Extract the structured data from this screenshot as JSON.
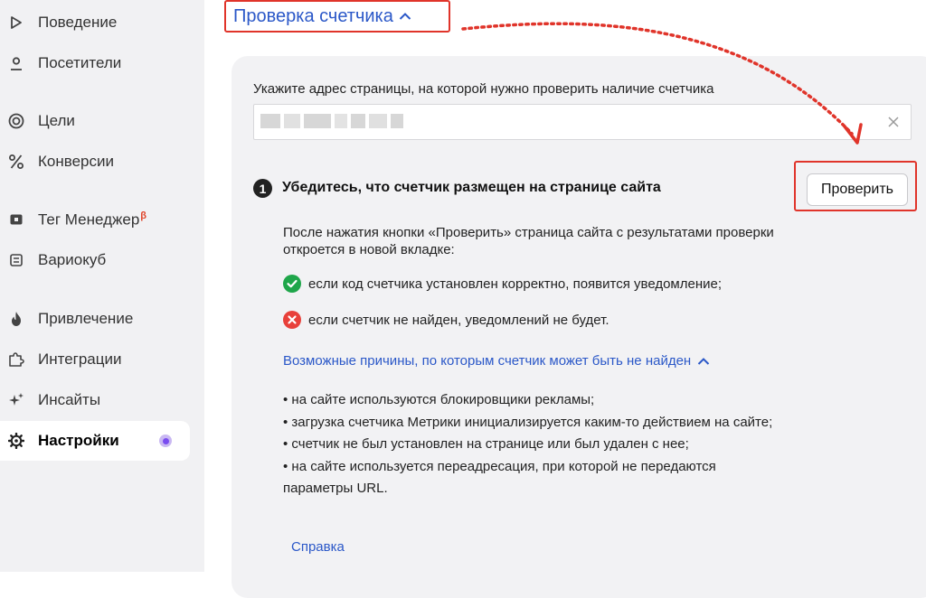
{
  "sidebar": {
    "items": [
      {
        "label": "Поведение",
        "icon": "play-outline-icon"
      },
      {
        "label": "Посетители",
        "icon": "person-icon"
      },
      {
        "label": "Цели",
        "icon": "target-icon"
      },
      {
        "label": "Конверсии",
        "icon": "percent-icon"
      },
      {
        "label": "Тег Менеджер",
        "badge": "β",
        "icon": "tag-manager-icon"
      },
      {
        "label": "Вариокуб",
        "icon": "variocube-icon"
      },
      {
        "label": "Привлечение",
        "icon": "fire-icon"
      },
      {
        "label": "Интеграции",
        "icon": "puzzle-icon"
      },
      {
        "label": "Инсайты",
        "icon": "sparkles-icon"
      },
      {
        "label": "Настройки",
        "icon": "gear-icon",
        "active": true
      }
    ]
  },
  "section": {
    "title": "Проверка счетчика"
  },
  "url_check": {
    "label": "Укажите адрес страницы, на которой нужно проверить наличие счетчика",
    "input_value": ""
  },
  "step": {
    "number": "1",
    "title": "Убедитесь, что счетчик размещен на странице сайта",
    "button_label": "Проверить",
    "description": "После нажатия кнопки «Проверить» страница сайта с результатами проверки откроется в новой вкладке:",
    "success_text": "если код счетчика установлен корректно, появится уведомление;",
    "fail_text": "если счетчик не найден, уведомлений не будет."
  },
  "reasons": {
    "link_label": "Возможные причины, по которым счетчик может быть не найден",
    "items": [
      "• на сайте используются блокировщики рекламы;",
      "• загрузка счетчика Метрики инициализируется каким-то действием на сайте;",
      "• счетчик не был установлен на странице или был удален с нее;",
      "• на сайте используется переадресация, при которой не передаются параметры URL."
    ]
  },
  "help_link": "Справка",
  "colors": {
    "accent_link": "#2b58c8",
    "annotation_red": "#e0342a",
    "success_green": "#1fa64a",
    "error_red": "#e8403a",
    "active_dot": "#7a4cf0"
  }
}
